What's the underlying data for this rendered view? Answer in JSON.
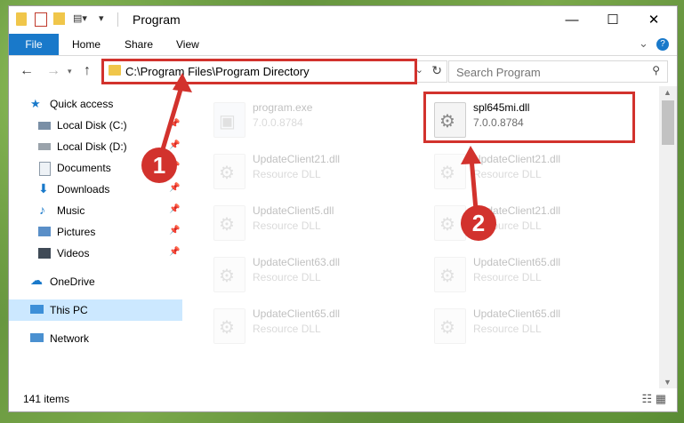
{
  "window": {
    "title": "Program",
    "minimize": "—",
    "maximize": "☐",
    "close": "✕"
  },
  "ribbon": {
    "file": "File",
    "home": "Home",
    "share": "Share",
    "view": "View",
    "expand": "⌄",
    "help": "?"
  },
  "address": {
    "path": "C:\\Program Files\\Program Directory",
    "search_placeholder": "Search Program"
  },
  "sidebar": {
    "quick_access": "Quick access",
    "local_c": "Local Disk (C:)",
    "local_d": "Local Disk (D:)",
    "documents": "Documents",
    "downloads": "Downloads",
    "music": "Music",
    "pictures": "Pictures",
    "videos": "Videos",
    "onedrive": "OneDrive",
    "this_pc": "This PC",
    "network": "Network"
  },
  "files": {
    "program_exe": {
      "name": "program.exe",
      "sub": "7.0.0.8784"
    },
    "spl": {
      "name": "spl645mi.dll",
      "sub": "7.0.0.8784"
    },
    "uc21a": {
      "name": "UpdateClient21.dll",
      "sub": "Resource DLL"
    },
    "uc21b": {
      "name": "UpdateClient21.dll",
      "sub": "Resource DLL"
    },
    "uc5": {
      "name": "UpdateClient5.dll",
      "sub": "Resource DLL"
    },
    "uc21c": {
      "name": "UpdateClient21.dll",
      "sub": "Resource DLL"
    },
    "uc63": {
      "name": "UpdateClient63.dll",
      "sub": "Resource DLL"
    },
    "uc65a": {
      "name": "UpdateClient65.dll",
      "sub": "Resource DLL"
    },
    "uc65b": {
      "name": "UpdateClient65.dll",
      "sub": "Resource DLL"
    },
    "uc65c": {
      "name": "UpdateClient65.dll",
      "sub": "Resource DLL"
    }
  },
  "status": {
    "count": "141 items"
  },
  "annotations": {
    "step1": "1",
    "step2": "2"
  },
  "colors": {
    "accent": "#1979ca",
    "annotation_red": "#d2322d",
    "selection": "#cce8ff"
  }
}
